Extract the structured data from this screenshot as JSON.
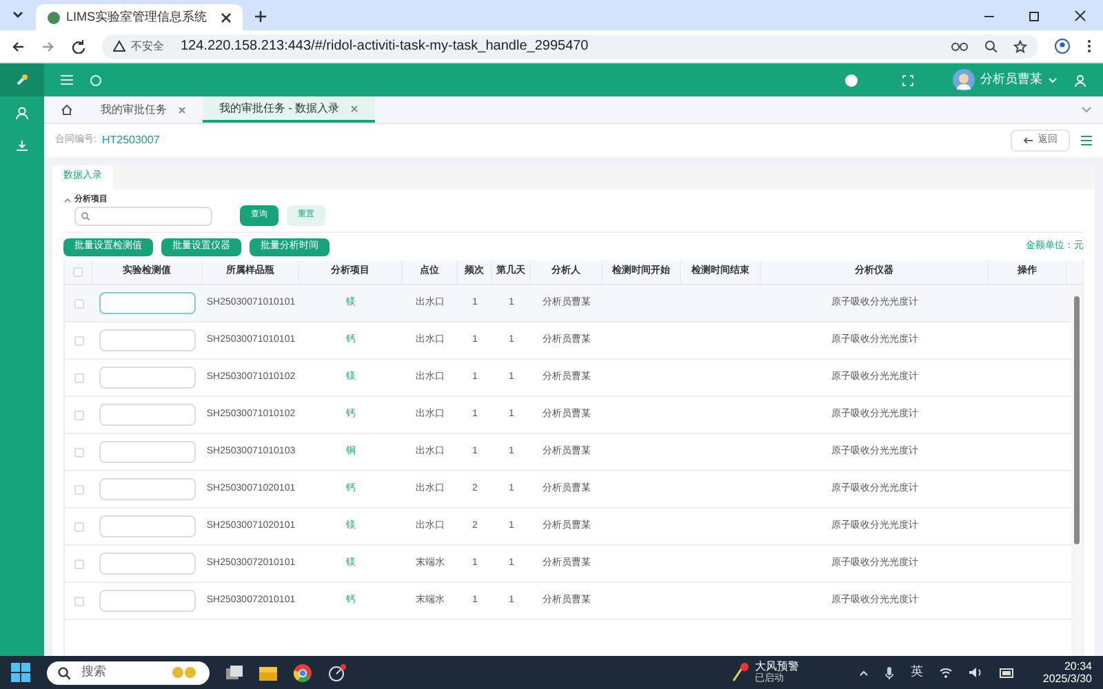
{
  "browser": {
    "tab_title": "LIMS实验室管理信息系统",
    "security": "不安全",
    "url": "124.220.158.213:443/#/ridol-activiti-task-my-task_handle_2995470"
  },
  "header": {
    "user": "分析员曹某"
  },
  "page_tabs": [
    {
      "label": "我的审批任务",
      "selected": false
    },
    {
      "label": "我的审批任务 - 数据入录",
      "selected": true
    }
  ],
  "contract": {
    "label": "合同编号:",
    "value": "HT2503007"
  },
  "back_button": "返回",
  "section_tab": "数据入录",
  "filter": {
    "label": "分析项目",
    "search": "查询",
    "reset": "重置"
  },
  "batch_buttons": [
    "批量设置检测值",
    "批量设置仪器",
    "批量分析时间"
  ],
  "unit_note": "金额单位：元",
  "table": {
    "all_checked": false,
    "columns": [
      "实验检测值",
      "所属样品瓶",
      "分析项目",
      "点位",
      "频次",
      "第几天",
      "分析人",
      "检测时间开始",
      "检测时间结束",
      "分析仪器",
      "操作"
    ],
    "rows": [
      {
        "checked": false,
        "hovered": true,
        "bottle": "SH25030071010101",
        "item": "镁",
        "point": "出水口",
        "freq": "1",
        "day": "1",
        "analyst": "分析员曹某",
        "instrument": "原子吸收分光光度计"
      },
      {
        "checked": false,
        "hovered": false,
        "bottle": "SH25030071010101",
        "item": "钙",
        "point": "出水口",
        "freq": "1",
        "day": "1",
        "analyst": "分析员曹某",
        "instrument": "原子吸收分光光度计"
      },
      {
        "checked": false,
        "hovered": false,
        "bottle": "SH25030071010102",
        "item": "镁",
        "point": "出水口",
        "freq": "1",
        "day": "1",
        "analyst": "分析员曹某",
        "instrument": "原子吸收分光光度计"
      },
      {
        "checked": false,
        "hovered": false,
        "bottle": "SH25030071010102",
        "item": "钙",
        "point": "出水口",
        "freq": "1",
        "day": "1",
        "analyst": "分析员曹某",
        "instrument": "原子吸收分光光度计"
      },
      {
        "checked": false,
        "hovered": false,
        "bottle": "SH25030071010103",
        "item": "铜",
        "point": "出水口",
        "freq": "1",
        "day": "1",
        "analyst": "分析员曹某",
        "instrument": "原子吸收分光光度计"
      },
      {
        "checked": false,
        "hovered": false,
        "bottle": "SH25030071020101",
        "item": "钙",
        "point": "出水口",
        "freq": "2",
        "day": "1",
        "analyst": "分析员曹某",
        "instrument": "原子吸收分光光度计"
      },
      {
        "checked": false,
        "hovered": false,
        "bottle": "SH25030071020101",
        "item": "镁",
        "point": "出水口",
        "freq": "2",
        "day": "1",
        "analyst": "分析员曹某",
        "instrument": "原子吸收分光光度计"
      },
      {
        "checked": false,
        "hovered": false,
        "bottle": "SH25030072010101",
        "item": "镁",
        "point": "末端水",
        "freq": "1",
        "day": "1",
        "analyst": "分析员曹某",
        "instrument": "原子吸收分光光度计"
      },
      {
        "checked": false,
        "hovered": false,
        "bottle": "SH25030072010101",
        "item": "钙",
        "point": "末端水",
        "freq": "1",
        "day": "1",
        "analyst": "分析员曹某",
        "instrument": "原子吸收分光光度计"
      }
    ]
  },
  "taskbar": {
    "search_placeholder": "搜索",
    "notice_title": "大风预警",
    "notice_status": "已启动",
    "ime": "英",
    "time": "20:34",
    "date": "2025/3/30"
  }
}
